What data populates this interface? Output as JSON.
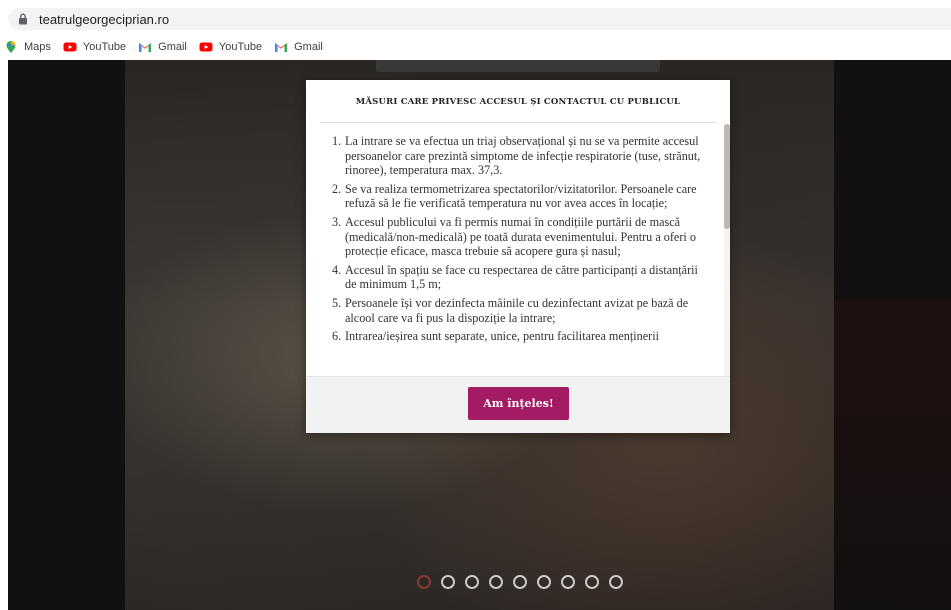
{
  "browser": {
    "url": "teatrulgeorgeciprian.ro",
    "bookmarks": [
      {
        "label": "Maps",
        "icon": "maps-icon"
      },
      {
        "label": "YouTube",
        "icon": "youtube-icon"
      },
      {
        "label": "Gmail",
        "icon": "gmail-icon"
      },
      {
        "label": "YouTube",
        "icon": "youtube-icon"
      },
      {
        "label": "Gmail",
        "icon": "gmail-icon"
      }
    ]
  },
  "modal": {
    "title": "MĂSURI CARE PRIVESC ACCESUL ȘI CONTACTUL CU PUBLICUL",
    "rules": [
      {
        "num": "1.",
        "text": "La intrare se va efectua un triaj observațional și nu se va permite accesul persoanelor care prezintă simptome de infecție respiratorie (tuse, strănut, rinoree), temperatura max. 37,3."
      },
      {
        "num": "2.",
        "text": "Se va realiza termometrizarea spectatorilor/vizitatorilor. Persoanele care refuză să le fie verificată temperatura nu vor avea acces în locație;"
      },
      {
        "num": "3.",
        "text": "Accesul publicului va fi permis numai în condițiile purtării de mască (medicală/non-medicală) pe toată durata evenimentului. Pentru a oferi o protecție eficace, masca trebuie să acopere gura și nasul;"
      },
      {
        "num": "4.",
        "text": "Accesul în spațiu se face cu respectarea de către participanți a distanțării de minimum 1,5 m;"
      },
      {
        "num": "5.",
        "text": "Persoanele își vor dezinfecta mâinile cu dezinfectant avizat pe bază de alcool care va fi pus la dispoziție la intrare;"
      },
      {
        "num": "6.",
        "text": "Intrarea/ieșirea sunt separate, unice, pentru facilitarea menținerii"
      }
    ],
    "button_label": "Am înțeles!"
  },
  "slider": {
    "dot_count": 9,
    "active_index": 0
  },
  "colors": {
    "accent": "#a31b62",
    "page_background": "#0f0d0c"
  }
}
